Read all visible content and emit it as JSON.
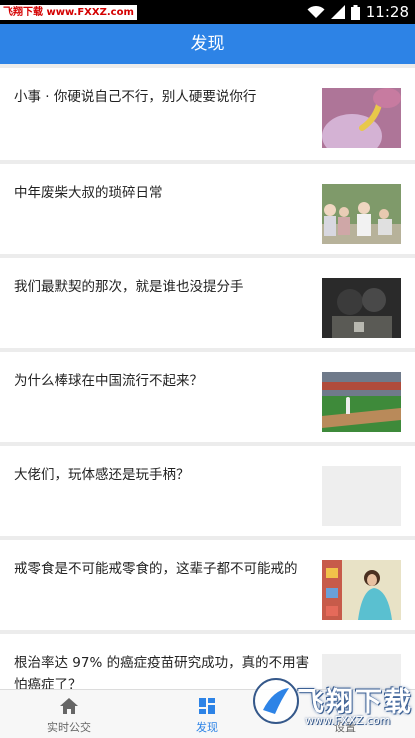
{
  "status_bar": {
    "watermark": "飞翔下载 www.FXXZ.com",
    "time": "11:28"
  },
  "app_bar": {
    "title": "发现"
  },
  "feed": {
    "items": [
      {
        "title": "小事 · 你硬说自己不行，别人硬要说你行"
      },
      {
        "title": "中年废柴大叔的琐碎日常"
      },
      {
        "title": "我们最默契的那次，就是谁也没提分手"
      },
      {
        "title": "为什么棒球在中国流行不起来？"
      },
      {
        "title": "大佬们，玩体感还是玩手柄？"
      },
      {
        "title": "戒零食是不可能戒零食的，这辈子都不可能戒的"
      },
      {
        "title": "根治率达 97% 的癌症疫苗研究成功，真的不用害怕癌症了？"
      }
    ]
  },
  "tab_bar": {
    "tabs": [
      {
        "label": "实时公交",
        "icon": "home-icon"
      },
      {
        "label": "发现",
        "icon": "grid-icon",
        "active": true
      },
      {
        "label": "设置",
        "icon": "gear-icon"
      }
    ]
  },
  "watermark_bottom": {
    "brand": "飞翔下载",
    "url": "www.FXXZ.com"
  },
  "colors": {
    "primary": "#2d83e6"
  }
}
